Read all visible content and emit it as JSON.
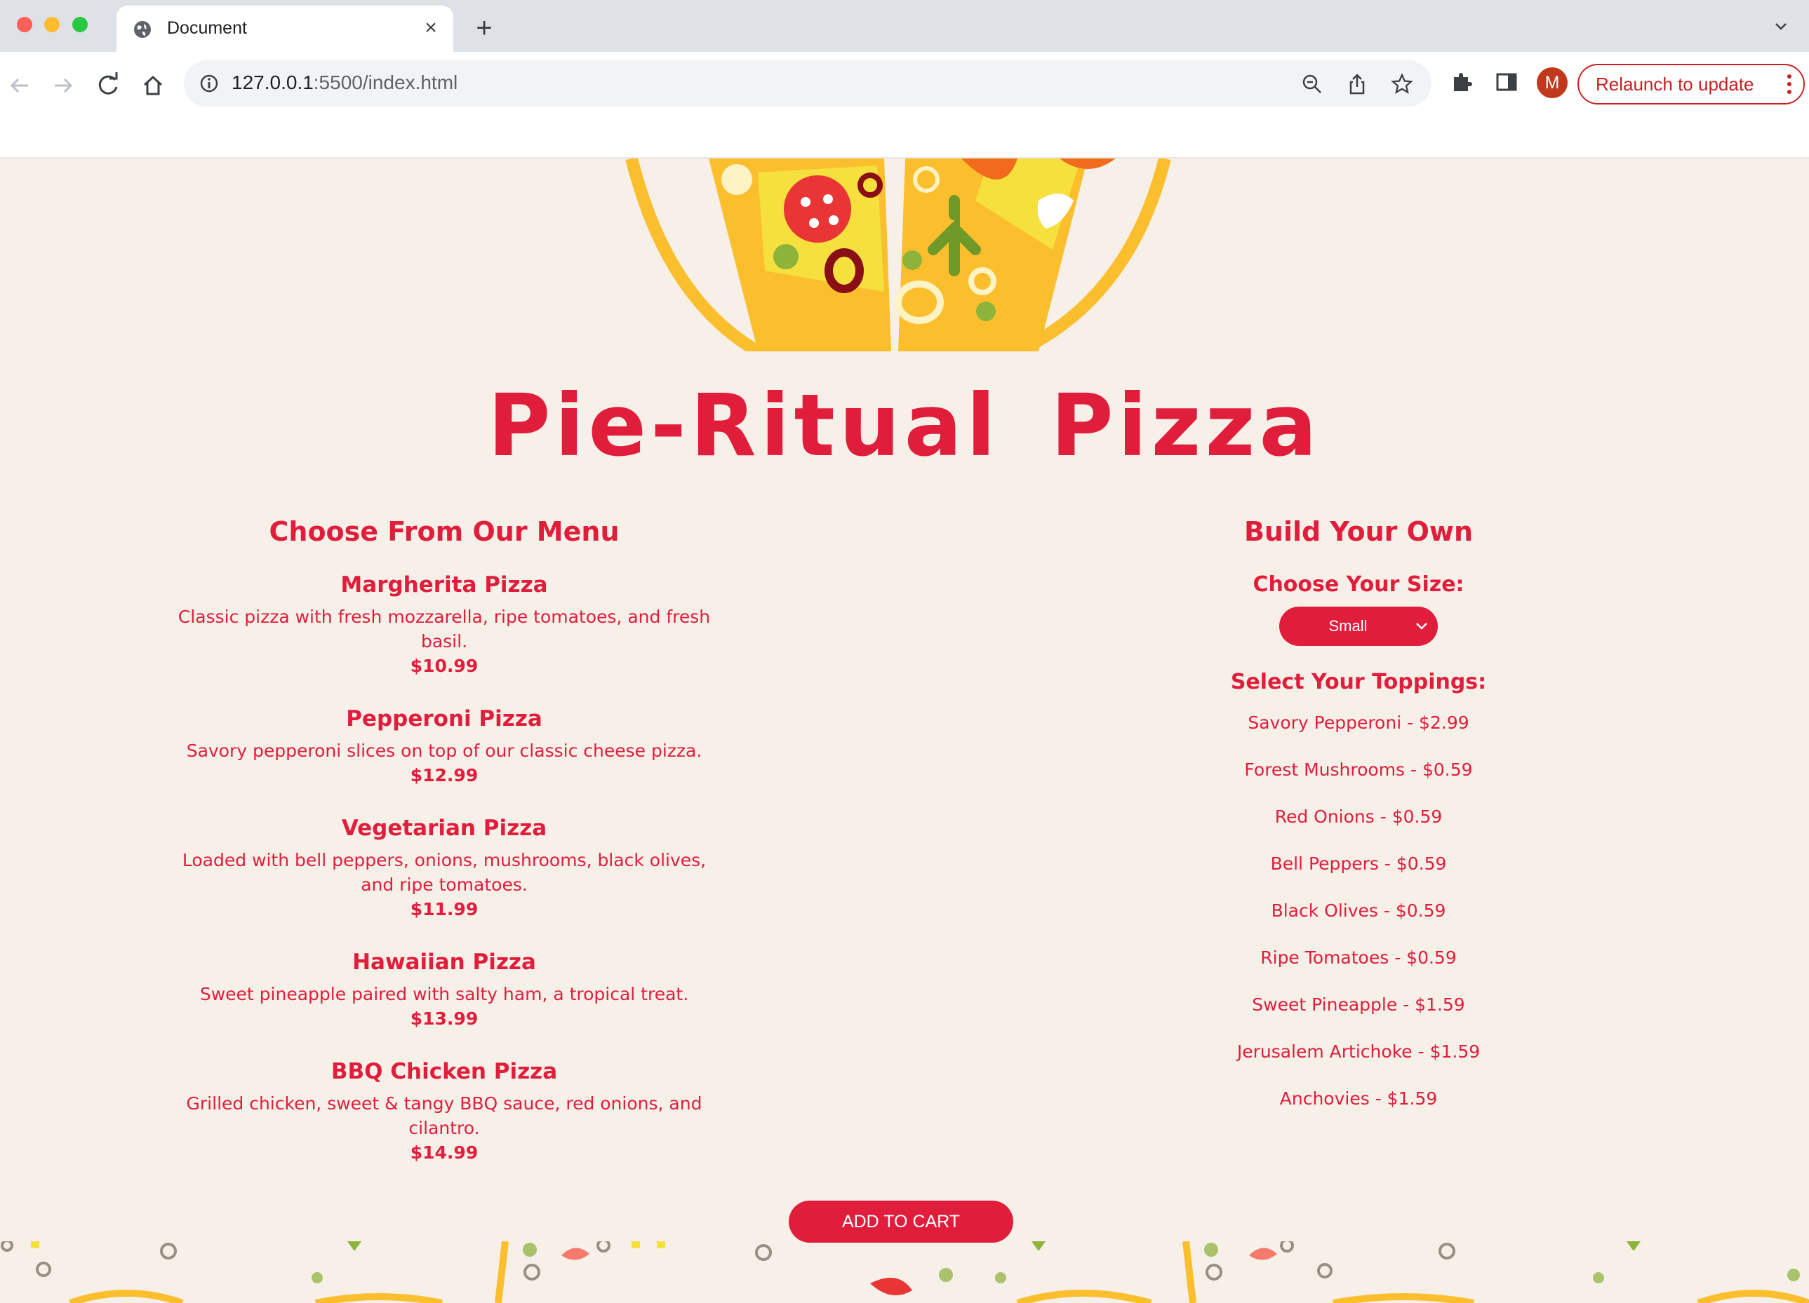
{
  "browser": {
    "tab_title": "Document",
    "tab_close": "×",
    "new_tab": "+",
    "url_host": "127.0.0.1",
    "url_rest": ":5500/index.html",
    "profile_initial": "M",
    "relaunch_label": "Relaunch to update"
  },
  "site": {
    "title": "Pie-Ritual Pizza"
  },
  "menu": {
    "heading": "Choose From Our Menu",
    "items": [
      {
        "name": "Margherita Pizza",
        "desc": "Classic pizza with fresh mozzarella, ripe tomatoes, and fresh basil.",
        "price": "$10.99"
      },
      {
        "name": "Pepperoni Pizza",
        "desc": "Savory pepperoni slices on top of our classic cheese pizza.",
        "price": "$12.99"
      },
      {
        "name": "Vegetarian Pizza",
        "desc": "Loaded with bell peppers, onions, mushrooms, black olives, and ripe tomatoes.",
        "price": "$11.99"
      },
      {
        "name": "Hawaiian Pizza",
        "desc": "Sweet pineapple paired with salty ham, a tropical treat.",
        "price": "$13.99"
      },
      {
        "name": "BBQ Chicken Pizza",
        "desc": "Grilled chicken, sweet & tangy BBQ sauce, red onions, and cilantro.",
        "price": "$14.99"
      }
    ]
  },
  "build": {
    "heading": "Build Your Own",
    "size_label": "Choose Your Size:",
    "size_selected": "Small",
    "toppings_label": "Select Your Toppings:",
    "toppings": [
      "Savory Pepperoni - $2.99",
      "Forest Mushrooms - $0.59",
      "Red Onions - $0.59",
      "Bell Peppers - $0.59",
      "Black Olives - $0.59",
      "Ripe Tomatoes - $0.59",
      "Sweet Pineapple - $1.59",
      "Jerusalem Artichoke - $1.59",
      "Anchovies - $1.59"
    ]
  },
  "cart": {
    "button_label": "ADD TO CART"
  },
  "colors": {
    "brand_red": "#e11d3c",
    "page_bg": "#f6f0e8",
    "crust_yellow": "#fbbf2e"
  }
}
